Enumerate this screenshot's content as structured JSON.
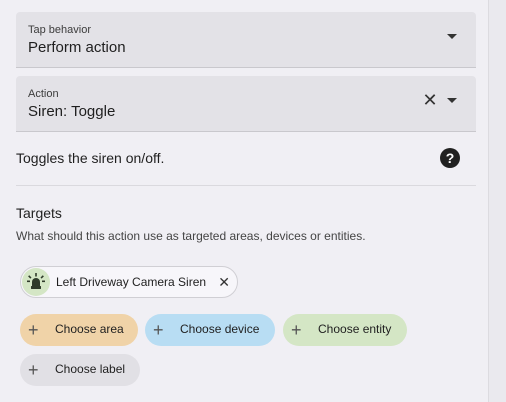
{
  "tap_behavior": {
    "label": "Tap behavior",
    "value": "Perform action"
  },
  "action": {
    "label": "Action",
    "value": "Siren: Toggle"
  },
  "description": "Toggles the siren on/off.",
  "targets": {
    "title": "Targets",
    "description": "What should this action use as targeted areas, devices or entities.",
    "selected": [
      {
        "label": "Left Driveway Camera Siren",
        "icon": "siren-icon"
      }
    ],
    "add_buttons": [
      {
        "label": "Choose area",
        "color": "#f0d3a8"
      },
      {
        "label": "Choose device",
        "color": "#b8ddf3"
      },
      {
        "label": "Choose entity",
        "color": "#d4e6c5"
      },
      {
        "label": "Choose label",
        "color": "#e1e0e5"
      }
    ]
  },
  "colors": {
    "panel_bg": "#f0eff4",
    "field_bg": "#e3e2e7",
    "entity_icon": "#2f3b2a"
  }
}
